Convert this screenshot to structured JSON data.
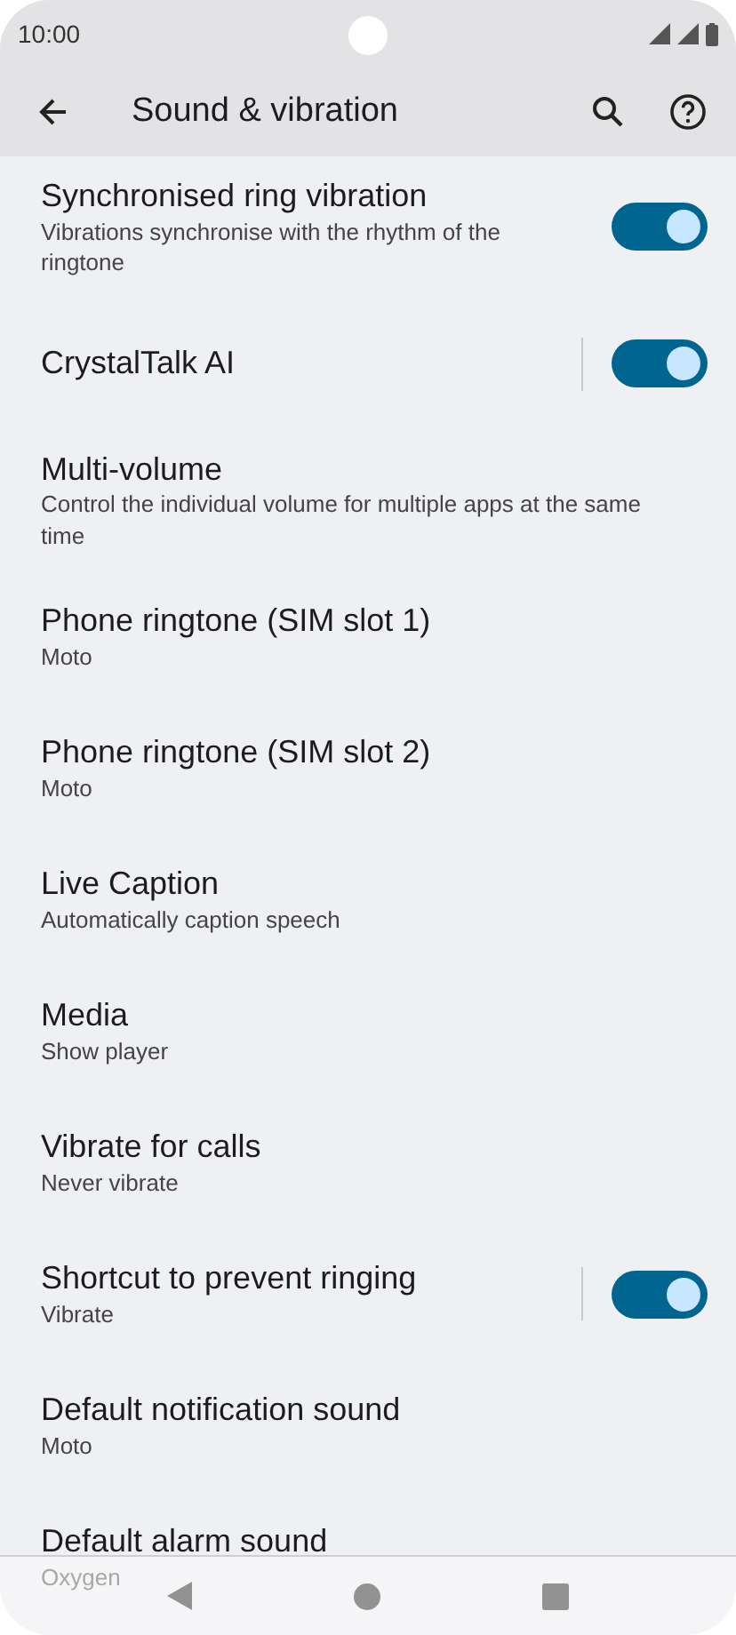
{
  "status_bar": {
    "time": "10:00"
  },
  "header": {
    "title": "Sound & vibration"
  },
  "items": [
    {
      "kind": "toggle",
      "title": "Synchronised ring vibration",
      "subtitle": "Vibrations synchronise with the rhythm of the ringtone",
      "on": true,
      "divider": false
    },
    {
      "kind": "toggle",
      "title": "CrystalTalk AI",
      "on": true,
      "divider": true
    },
    {
      "kind": "link",
      "title": "Multi-volume",
      "subtitle": "Control the individual volume for multiple apps at the same time"
    },
    {
      "kind": "link",
      "title": "Phone ringtone (SIM slot 1)",
      "subtitle": "Moto"
    },
    {
      "kind": "link",
      "title": "Phone ringtone (SIM slot 2)",
      "subtitle": "Moto"
    },
    {
      "kind": "link",
      "title": "Live Caption",
      "subtitle": "Automatically caption speech"
    },
    {
      "kind": "link",
      "title": "Media",
      "subtitle": "Show player"
    },
    {
      "kind": "link",
      "title": "Vibrate for calls",
      "subtitle": "Never vibrate"
    },
    {
      "kind": "toggle",
      "title": "Shortcut to prevent ringing",
      "subtitle": "Vibrate",
      "on": true,
      "divider": true
    },
    {
      "kind": "link",
      "title": "Default notification sound",
      "subtitle": "Moto"
    },
    {
      "kind": "link",
      "title": "Default alarm sound",
      "subtitle": "Oxygen"
    }
  ]
}
